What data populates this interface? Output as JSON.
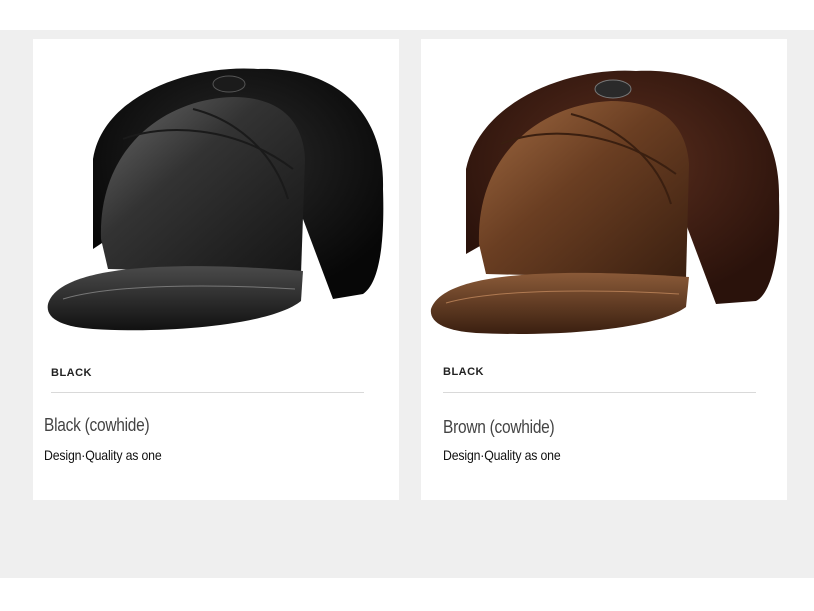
{
  "products": [
    {
      "image_alt": "black leather hat with fur ear flaps",
      "tag": "BLACK",
      "name": "Black (cowhide)",
      "tagline": "Design·Quality as one",
      "colors": {
        "fur": "#0d0d0d",
        "leather": "#2c2c2c",
        "leather_light": "#5a5a5a"
      }
    },
    {
      "image_alt": "brown leather hat with fur ear flaps",
      "tag": "BLACK",
      "name": "Brown (cowhide)",
      "tagline": "Design·Quality as one",
      "colors": {
        "fur": "#3a1c12",
        "leather": "#5a3520",
        "leather_light": "#8a5a38"
      }
    }
  ]
}
